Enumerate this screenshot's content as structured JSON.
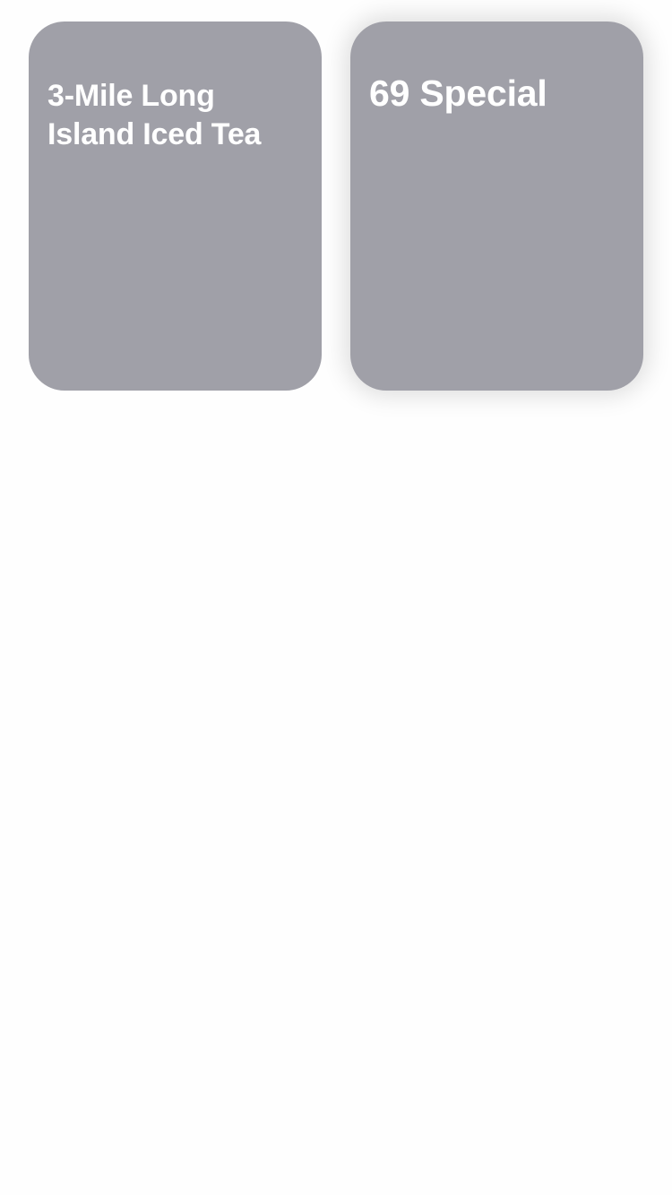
{
  "cards": [
    {
      "title": "3-Mile Long Island Iced Tea",
      "color": "#a0a0a8",
      "selected": false
    },
    {
      "title": "69 Special",
      "color": "#a0a0a8",
      "selected": true
    }
  ],
  "colors": {
    "background": "#fefefe",
    "card": "#a0a0a8",
    "card_text": "#ffffff"
  }
}
